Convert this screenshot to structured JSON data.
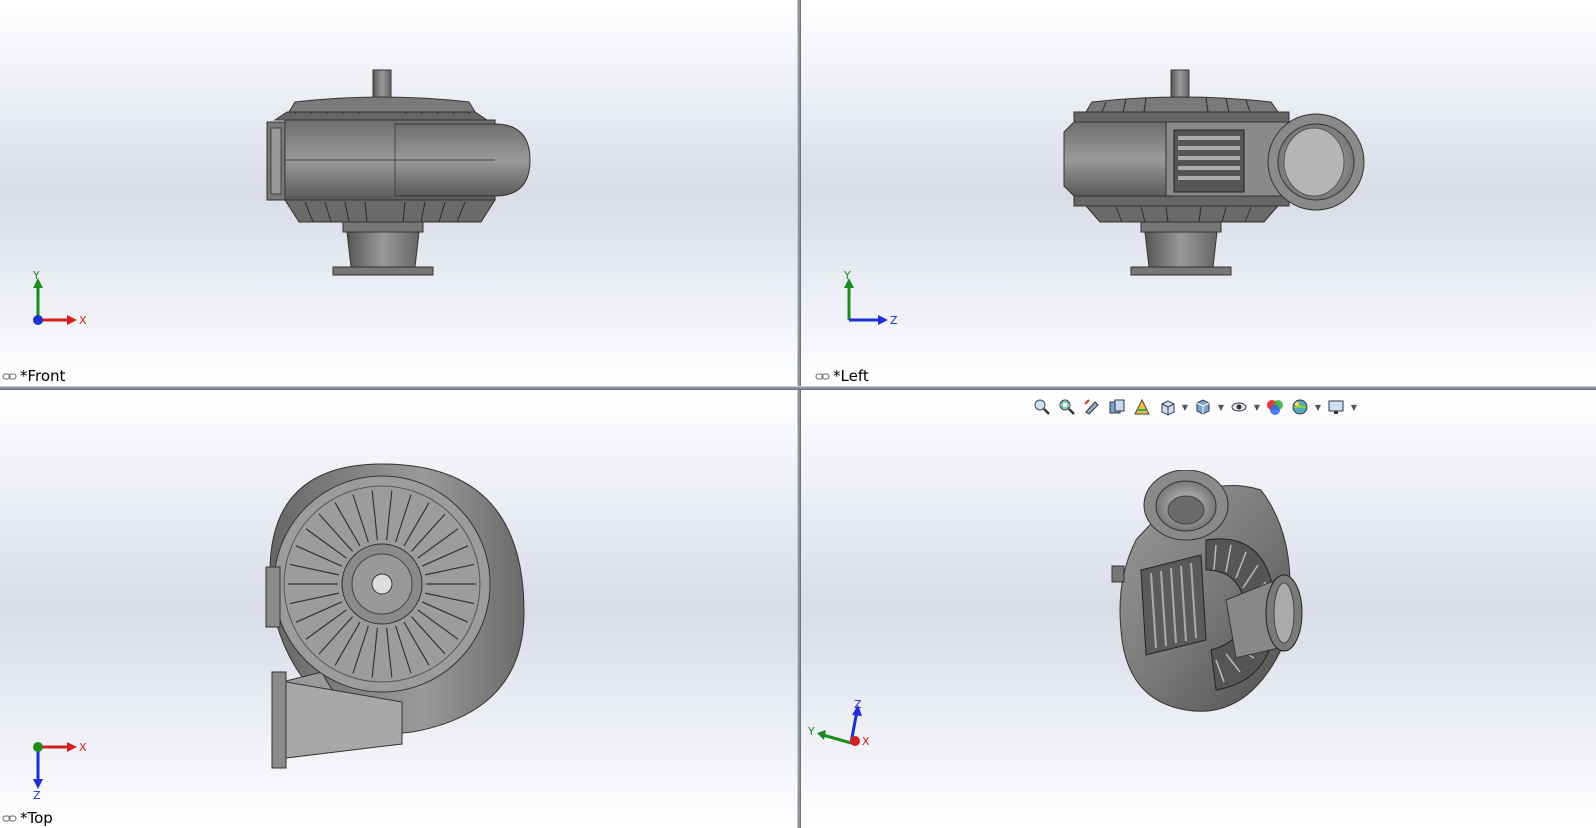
{
  "viewports": {
    "front": {
      "label": "*Front",
      "axes": {
        "h": "X",
        "v": "Y"
      }
    },
    "left": {
      "label": "*Left",
      "axes": {
        "h": "Z",
        "v": "Y"
      }
    },
    "top": {
      "label": "*Top",
      "axes": {
        "h": "X",
        "v": "Z"
      }
    },
    "iso": {
      "axes": {
        "a": "Z",
        "b": "Y",
        "c": "X"
      }
    }
  },
  "heads_up_toolbar": [
    {
      "icon": "zoom-to-fit-icon"
    },
    {
      "icon": "zoom-to-area-icon"
    },
    {
      "icon": "previous-view-icon"
    },
    {
      "icon": "section-view-icon"
    },
    {
      "icon": "dynamic-annotation-icon"
    },
    {
      "icon": "view-orientation-icon",
      "dropdown": true
    },
    {
      "icon": "display-style-icon",
      "dropdown": true
    },
    {
      "icon": "hide-show-items-icon",
      "dropdown": true
    },
    {
      "icon": "edit-appearance-icon"
    },
    {
      "icon": "apply-scene-icon",
      "dropdown": true
    },
    {
      "icon": "view-setting-icon",
      "dropdown": true
    }
  ],
  "colors": {
    "axis_x": "#d21f1f",
    "axis_y": "#1f8a1f",
    "axis_z": "#1f2fd2",
    "metal": "#8a8a8a",
    "metal_dark": "#4a4a4a"
  }
}
